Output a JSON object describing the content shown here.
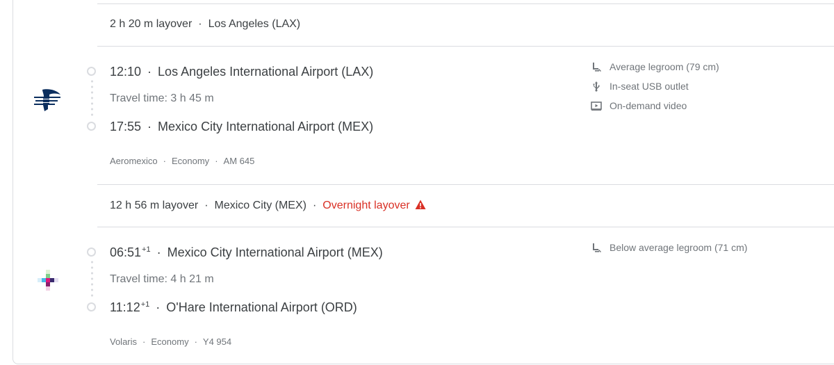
{
  "layovers": [
    {
      "duration": "2 h 20 m layover",
      "place": "Los Angeles (LAX)"
    },
    {
      "duration": "12 h 56 m layover",
      "place": "Mexico City (MEX)",
      "warning": "Overnight layover"
    }
  ],
  "segments": [
    {
      "airline_logo_icon": "aeromexico-logo-icon",
      "depart_time": "12:10",
      "depart_airport": "Los Angeles International Airport (LAX)",
      "travel_time": "Travel time: 3 h 45 m",
      "arrive_time": "17:55",
      "arrive_airport": "Mexico City International Airport (MEX)",
      "airline": "Aeromexico",
      "cabin": "Economy",
      "flight_number": "AM 645",
      "amenities": [
        {
          "icon": "legroom-icon",
          "label": "Average legroom (79 cm)"
        },
        {
          "icon": "usb-icon",
          "label": "In-seat USB outlet"
        },
        {
          "icon": "video-icon",
          "label": "On-demand video"
        }
      ]
    },
    {
      "airline_logo_icon": "volaris-logo-icon",
      "depart_time": "06:51",
      "depart_day_offset": "+1",
      "depart_airport": "Mexico City International Airport (MEX)",
      "travel_time": "Travel time: 4 h 21 m",
      "arrive_time": "11:12",
      "arrive_day_offset": "+1",
      "arrive_airport": "O'Hare International Airport (ORD)",
      "airline": "Volaris",
      "cabin": "Economy",
      "flight_number": "Y4 954",
      "amenities": [
        {
          "icon": "legroom-icon",
          "label": "Below average legroom (71 cm)"
        }
      ]
    }
  ],
  "separator": "·",
  "colors": {
    "warning": "#d93025",
    "text": "#3c4043",
    "muted": "#70757a",
    "divider": "#dadce0"
  }
}
